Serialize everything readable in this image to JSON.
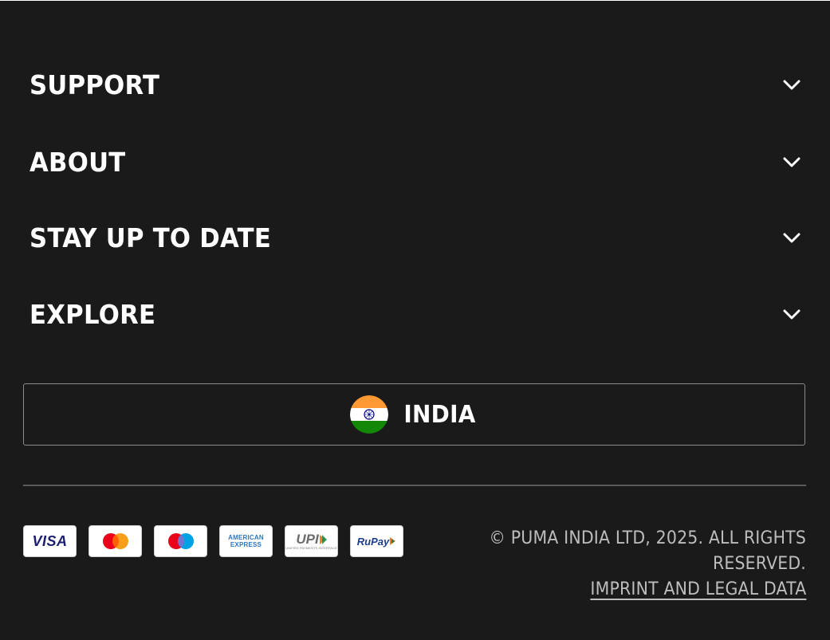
{
  "footer": {
    "sections": [
      {
        "label": "SUPPORT",
        "icon": "chevron-down-icon"
      },
      {
        "label": "ABOUT",
        "icon": "chevron-down-icon"
      },
      {
        "label": "STAY UP TO DATE",
        "icon": "chevron-down-icon"
      },
      {
        "label": "EXPLORE",
        "icon": "chevron-down-icon"
      }
    ],
    "country_selector": {
      "label": "INDIA",
      "flag_icon": "india-flag-icon"
    },
    "payment_methods": [
      {
        "name": "visa",
        "text": "VISA"
      },
      {
        "name": "mastercard",
        "text": ""
      },
      {
        "name": "maestro",
        "text": ""
      },
      {
        "name": "american-express",
        "text_line1": "AMERICAN",
        "text_line2": "EXPRESS"
      },
      {
        "name": "upi",
        "text": "UPI",
        "subtext": "UNIFIED PAYMENTS INTERFACE"
      },
      {
        "name": "rupay",
        "text": "RuPay"
      }
    ],
    "copyright": "© PUMA INDIA LTD, 2025. ALL RIGHTS RESERVED.",
    "imprint_link": "IMPRINT AND LEGAL DATA"
  },
  "colors": {
    "background": "#1a1a1a",
    "text": "#ffffff",
    "muted_text": "#bdbdbd",
    "border": "#8a8a8a",
    "divider": "#5a5a5a",
    "india_saffron": "#ff9933",
    "india_green": "#138808",
    "india_navy": "#000080"
  }
}
